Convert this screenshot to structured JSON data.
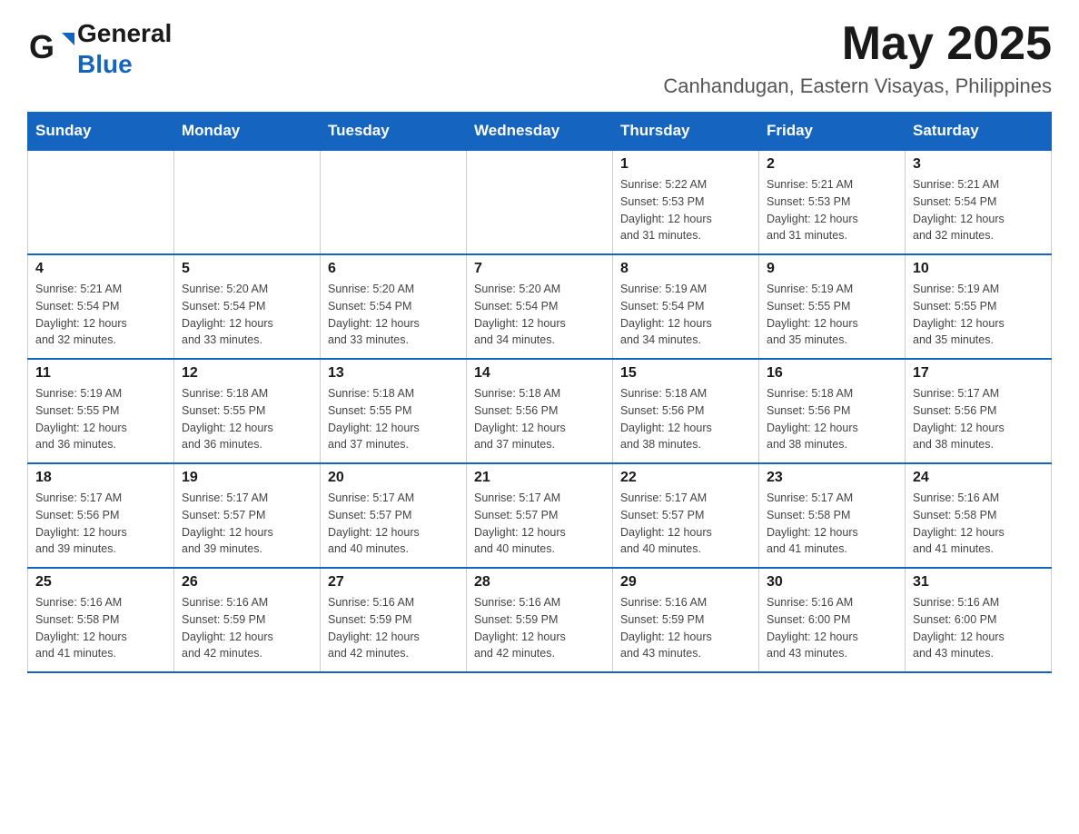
{
  "logo": {
    "general": "General",
    "blue": "Blue"
  },
  "title": {
    "month_year": "May 2025",
    "location": "Canhandugan, Eastern Visayas, Philippines"
  },
  "weekdays": [
    "Sunday",
    "Monday",
    "Tuesday",
    "Wednesday",
    "Thursday",
    "Friday",
    "Saturday"
  ],
  "weeks": [
    [
      {
        "day": "",
        "info": ""
      },
      {
        "day": "",
        "info": ""
      },
      {
        "day": "",
        "info": ""
      },
      {
        "day": "",
        "info": ""
      },
      {
        "day": "1",
        "info": "Sunrise: 5:22 AM\nSunset: 5:53 PM\nDaylight: 12 hours\nand 31 minutes."
      },
      {
        "day": "2",
        "info": "Sunrise: 5:21 AM\nSunset: 5:53 PM\nDaylight: 12 hours\nand 31 minutes."
      },
      {
        "day": "3",
        "info": "Sunrise: 5:21 AM\nSunset: 5:54 PM\nDaylight: 12 hours\nand 32 minutes."
      }
    ],
    [
      {
        "day": "4",
        "info": "Sunrise: 5:21 AM\nSunset: 5:54 PM\nDaylight: 12 hours\nand 32 minutes."
      },
      {
        "day": "5",
        "info": "Sunrise: 5:20 AM\nSunset: 5:54 PM\nDaylight: 12 hours\nand 33 minutes."
      },
      {
        "day": "6",
        "info": "Sunrise: 5:20 AM\nSunset: 5:54 PM\nDaylight: 12 hours\nand 33 minutes."
      },
      {
        "day": "7",
        "info": "Sunrise: 5:20 AM\nSunset: 5:54 PM\nDaylight: 12 hours\nand 34 minutes."
      },
      {
        "day": "8",
        "info": "Sunrise: 5:19 AM\nSunset: 5:54 PM\nDaylight: 12 hours\nand 34 minutes."
      },
      {
        "day": "9",
        "info": "Sunrise: 5:19 AM\nSunset: 5:55 PM\nDaylight: 12 hours\nand 35 minutes."
      },
      {
        "day": "10",
        "info": "Sunrise: 5:19 AM\nSunset: 5:55 PM\nDaylight: 12 hours\nand 35 minutes."
      }
    ],
    [
      {
        "day": "11",
        "info": "Sunrise: 5:19 AM\nSunset: 5:55 PM\nDaylight: 12 hours\nand 36 minutes."
      },
      {
        "day": "12",
        "info": "Sunrise: 5:18 AM\nSunset: 5:55 PM\nDaylight: 12 hours\nand 36 minutes."
      },
      {
        "day": "13",
        "info": "Sunrise: 5:18 AM\nSunset: 5:55 PM\nDaylight: 12 hours\nand 37 minutes."
      },
      {
        "day": "14",
        "info": "Sunrise: 5:18 AM\nSunset: 5:56 PM\nDaylight: 12 hours\nand 37 minutes."
      },
      {
        "day": "15",
        "info": "Sunrise: 5:18 AM\nSunset: 5:56 PM\nDaylight: 12 hours\nand 38 minutes."
      },
      {
        "day": "16",
        "info": "Sunrise: 5:18 AM\nSunset: 5:56 PM\nDaylight: 12 hours\nand 38 minutes."
      },
      {
        "day": "17",
        "info": "Sunrise: 5:17 AM\nSunset: 5:56 PM\nDaylight: 12 hours\nand 38 minutes."
      }
    ],
    [
      {
        "day": "18",
        "info": "Sunrise: 5:17 AM\nSunset: 5:56 PM\nDaylight: 12 hours\nand 39 minutes."
      },
      {
        "day": "19",
        "info": "Sunrise: 5:17 AM\nSunset: 5:57 PM\nDaylight: 12 hours\nand 39 minutes."
      },
      {
        "day": "20",
        "info": "Sunrise: 5:17 AM\nSunset: 5:57 PM\nDaylight: 12 hours\nand 40 minutes."
      },
      {
        "day": "21",
        "info": "Sunrise: 5:17 AM\nSunset: 5:57 PM\nDaylight: 12 hours\nand 40 minutes."
      },
      {
        "day": "22",
        "info": "Sunrise: 5:17 AM\nSunset: 5:57 PM\nDaylight: 12 hours\nand 40 minutes."
      },
      {
        "day": "23",
        "info": "Sunrise: 5:17 AM\nSunset: 5:58 PM\nDaylight: 12 hours\nand 41 minutes."
      },
      {
        "day": "24",
        "info": "Sunrise: 5:16 AM\nSunset: 5:58 PM\nDaylight: 12 hours\nand 41 minutes."
      }
    ],
    [
      {
        "day": "25",
        "info": "Sunrise: 5:16 AM\nSunset: 5:58 PM\nDaylight: 12 hours\nand 41 minutes."
      },
      {
        "day": "26",
        "info": "Sunrise: 5:16 AM\nSunset: 5:59 PM\nDaylight: 12 hours\nand 42 minutes."
      },
      {
        "day": "27",
        "info": "Sunrise: 5:16 AM\nSunset: 5:59 PM\nDaylight: 12 hours\nand 42 minutes."
      },
      {
        "day": "28",
        "info": "Sunrise: 5:16 AM\nSunset: 5:59 PM\nDaylight: 12 hours\nand 42 minutes."
      },
      {
        "day": "29",
        "info": "Sunrise: 5:16 AM\nSunset: 5:59 PM\nDaylight: 12 hours\nand 43 minutes."
      },
      {
        "day": "30",
        "info": "Sunrise: 5:16 AM\nSunset: 6:00 PM\nDaylight: 12 hours\nand 43 minutes."
      },
      {
        "day": "31",
        "info": "Sunrise: 5:16 AM\nSunset: 6:00 PM\nDaylight: 12 hours\nand 43 minutes."
      }
    ]
  ],
  "colors": {
    "header_bg": "#1565c0",
    "header_text": "#ffffff",
    "border": "#cccccc",
    "row_border": "#1565c0"
  }
}
